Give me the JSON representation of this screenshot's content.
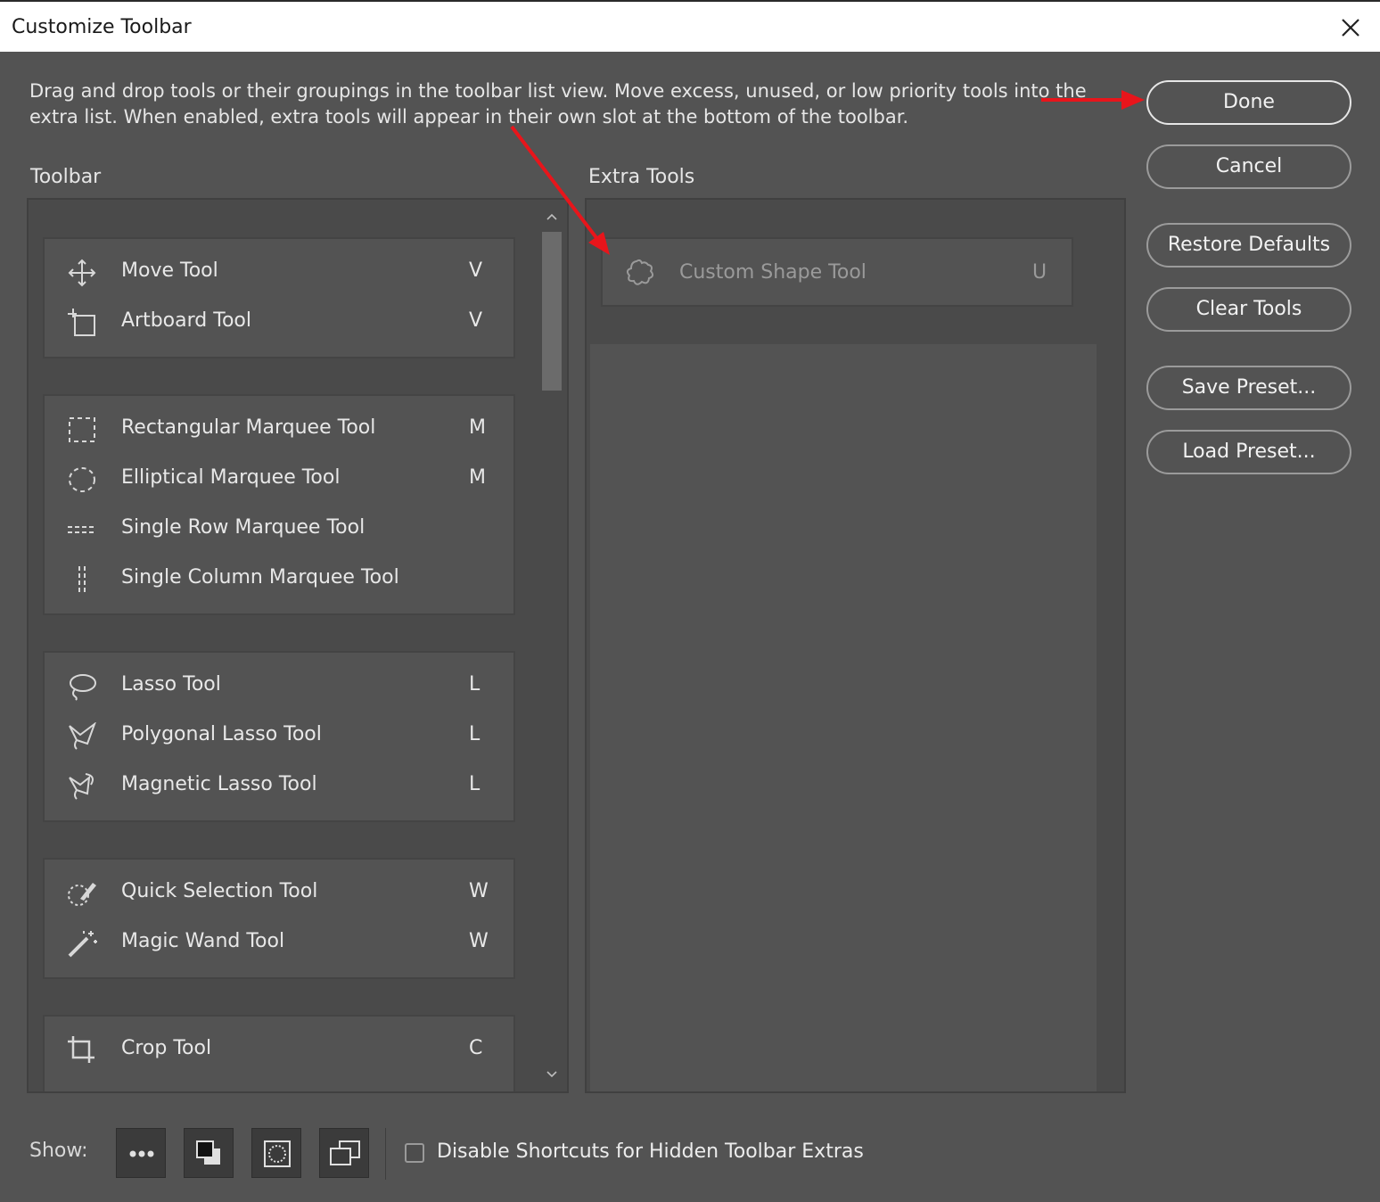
{
  "window": {
    "title": "Customize Toolbar"
  },
  "description": "Drag and drop tools or their groupings in the toolbar list view. Move excess, unused, or low priority tools into the extra list. When enabled, extra tools will appear in their own slot at the bottom of the toolbar.",
  "toolbar": {
    "label": "Toolbar",
    "groups": [
      {
        "tools": [
          {
            "name": "Move Tool",
            "key": "V",
            "icon": "move-icon"
          },
          {
            "name": "Artboard Tool",
            "key": "V",
            "icon": "artboard-icon"
          }
        ]
      },
      {
        "tools": [
          {
            "name": "Rectangular Marquee Tool",
            "key": "M",
            "icon": "rect-marquee-icon"
          },
          {
            "name": "Elliptical Marquee Tool",
            "key": "M",
            "icon": "ellipse-marquee-icon"
          },
          {
            "name": "Single Row Marquee Tool",
            "key": "",
            "icon": "single-row-icon"
          },
          {
            "name": "Single Column Marquee Tool",
            "key": "",
            "icon": "single-column-icon"
          }
        ]
      },
      {
        "tools": [
          {
            "name": "Lasso Tool",
            "key": "L",
            "icon": "lasso-icon"
          },
          {
            "name": "Polygonal Lasso Tool",
            "key": "L",
            "icon": "polygonal-lasso-icon"
          },
          {
            "name": "Magnetic Lasso Tool",
            "key": "L",
            "icon": "magnetic-lasso-icon"
          }
        ]
      },
      {
        "tools": [
          {
            "name": "Quick Selection Tool",
            "key": "W",
            "icon": "quick-selection-icon"
          },
          {
            "name": "Magic Wand Tool",
            "key": "W",
            "icon": "magic-wand-icon"
          }
        ]
      },
      {
        "tools": [
          {
            "name": "Crop Tool",
            "key": "C",
            "icon": "crop-icon"
          }
        ]
      }
    ]
  },
  "extra_tools": {
    "label": "Extra Tools",
    "items": [
      {
        "name": "Custom Shape Tool",
        "key": "U",
        "icon": "custom-shape-icon"
      }
    ]
  },
  "buttons": {
    "done": "Done",
    "cancel": "Cancel",
    "restore_defaults": "Restore Defaults",
    "clear_tools": "Clear Tools",
    "save_preset": "Save Preset...",
    "load_preset": "Load Preset..."
  },
  "footer": {
    "show_label": "Show:",
    "show_buttons": [
      "more-icon",
      "fill-colors-icon",
      "quick-mask-icon",
      "screen-mode-icon"
    ],
    "checkbox_label": "Disable Shortcuts for Hidden Toolbar Extras",
    "checkbox_checked": false
  },
  "colors": {
    "dialog_bg": "#535353",
    "panel_bg": "#4a4a4a",
    "annotation_arrow": "#e8151b"
  }
}
